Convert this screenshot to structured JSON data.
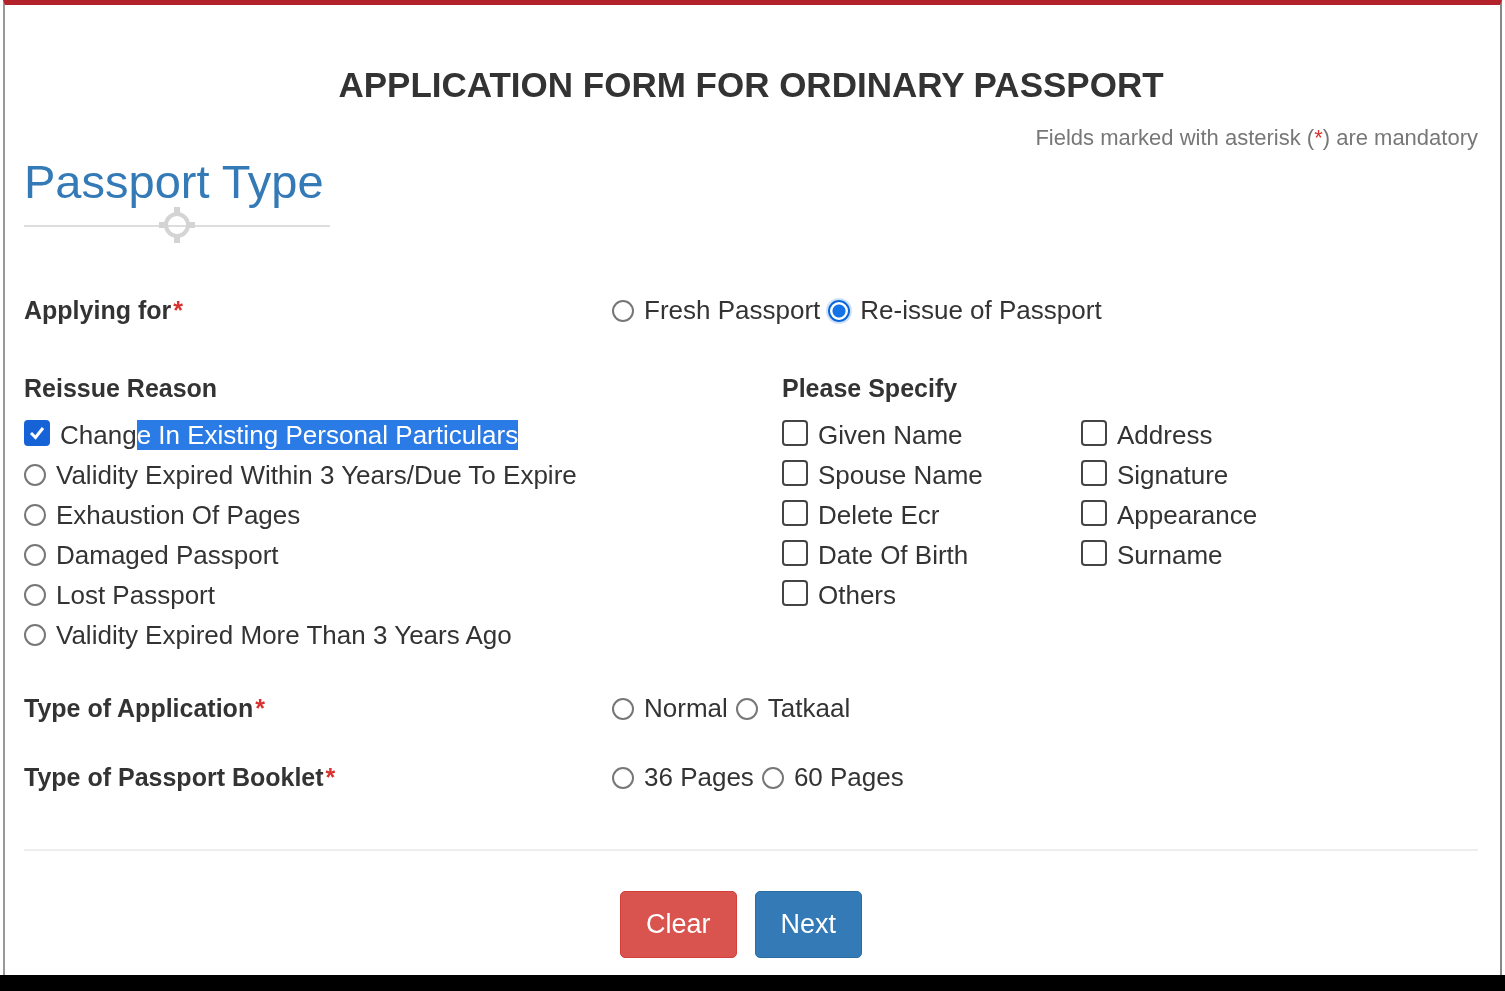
{
  "title": "APPLICATION FORM FOR ORDINARY PASSPORT",
  "mandatory_note": {
    "before": "Fields marked with asterisk (",
    "asterisk": "*",
    "after": ") are mandatory"
  },
  "section_title": "Passport Type",
  "applying_for": {
    "label": "Applying for",
    "required": true,
    "options": [
      {
        "label": "Fresh Passport",
        "selected": false
      },
      {
        "label": "Re-issue of Passport",
        "selected": true
      }
    ]
  },
  "reissue_reason": {
    "label": "Reissue Reason",
    "options": [
      {
        "kind": "checkbox",
        "label": "Chang",
        "label_selected": "e In Existing Personal Particulars",
        "selected": true
      },
      {
        "kind": "radio",
        "label": "Validity Expired Within 3 Years/Due To Expire",
        "selected": false
      },
      {
        "kind": "radio",
        "label": "Exhaustion Of Pages",
        "selected": false
      },
      {
        "kind": "radio",
        "label": "Damaged Passport",
        "selected": false
      },
      {
        "kind": "radio",
        "label": "Lost Passport",
        "selected": false
      },
      {
        "kind": "radio",
        "label": "Validity Expired More Than 3 Years Ago",
        "selected": false
      }
    ]
  },
  "please_specify": {
    "label": "Please Specify",
    "columns": [
      [
        {
          "label": "Given Name",
          "checked": false
        },
        {
          "label": "Spouse Name",
          "checked": false
        },
        {
          "label": "Delete Ecr",
          "checked": false
        },
        {
          "label": "Date Of Birth",
          "checked": false
        },
        {
          "label": "Others",
          "checked": false
        }
      ],
      [
        {
          "label": "Address",
          "checked": false
        },
        {
          "label": "Signature",
          "checked": false
        },
        {
          "label": "Appearance",
          "checked": false
        },
        {
          "label": "Surname",
          "checked": false
        }
      ]
    ]
  },
  "type_of_application": {
    "label": "Type of Application",
    "required": true,
    "options": [
      {
        "label": "Normal",
        "selected": false
      },
      {
        "label": "Tatkaal",
        "selected": false
      }
    ]
  },
  "type_of_booklet": {
    "label": "Type of Passport Booklet",
    "required": true,
    "options": [
      {
        "label": "36 Pages",
        "selected": false
      },
      {
        "label": "60 Pages",
        "selected": false
      }
    ]
  },
  "buttons": [
    {
      "label": "Clear",
      "kind": "danger"
    },
    {
      "label": "Next",
      "kind": "primary"
    }
  ]
}
